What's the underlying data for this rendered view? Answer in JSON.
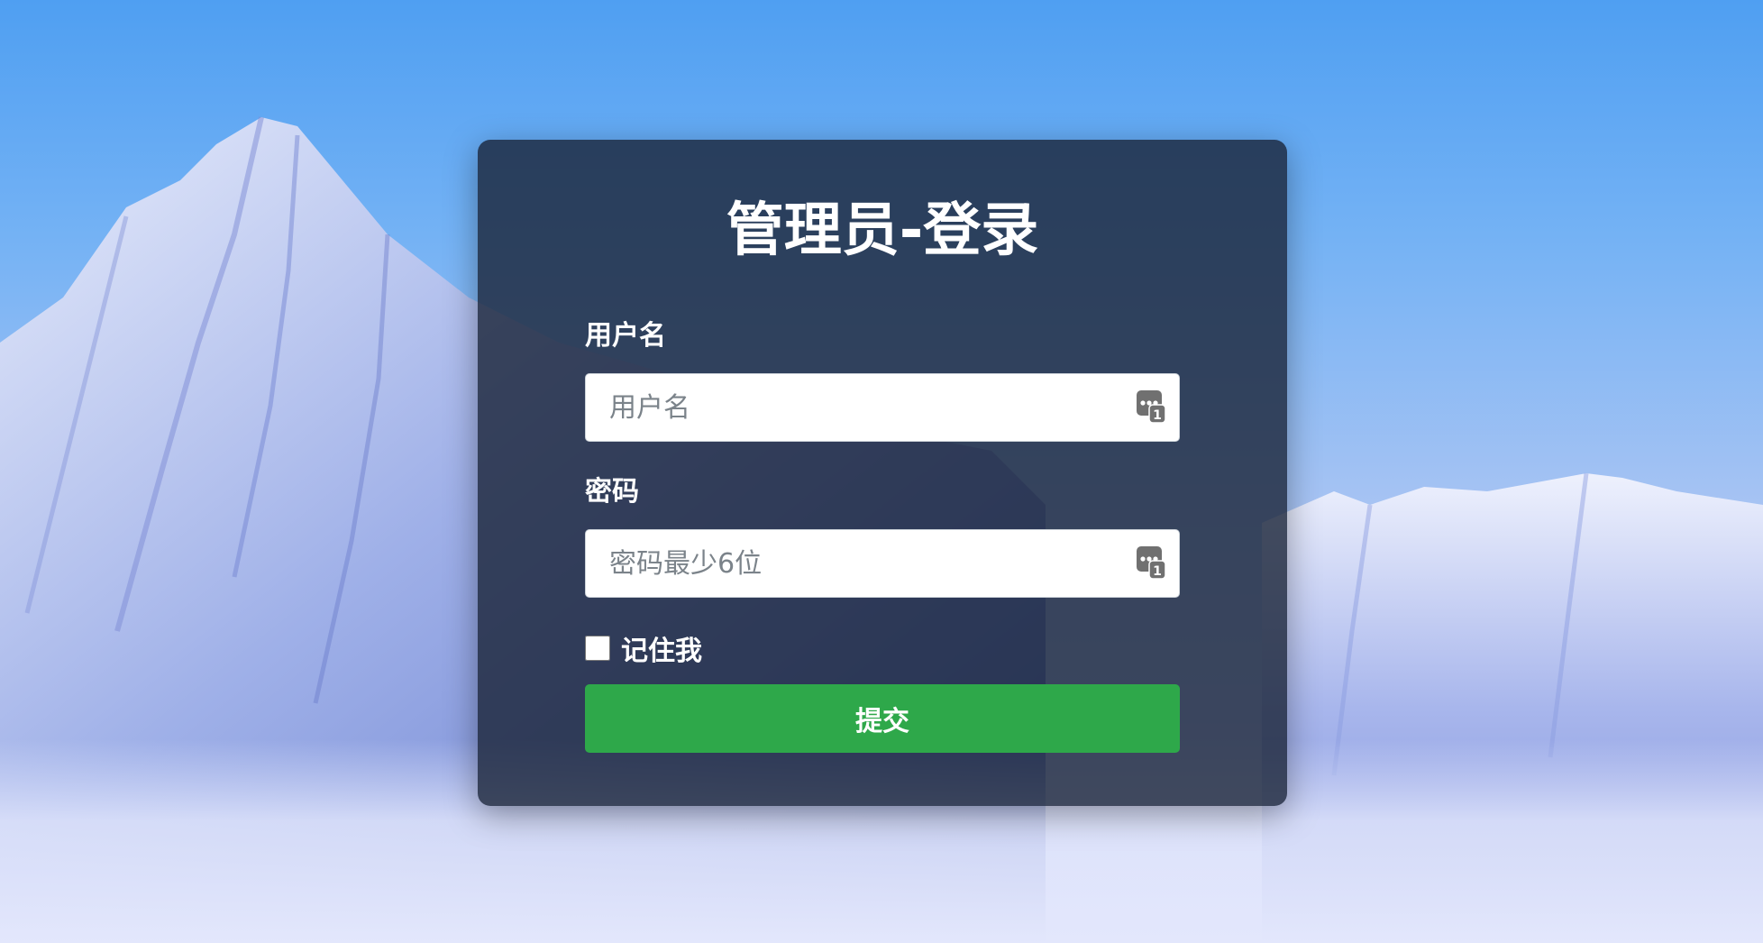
{
  "page": {
    "title": "管理员-登录"
  },
  "form": {
    "username": {
      "label": "用户名",
      "value": "",
      "placeholder": "用户名"
    },
    "password": {
      "label": "密码",
      "value": "",
      "placeholder": "密码最少6位"
    },
    "remember_me": {
      "label": "记住我",
      "checked": false
    },
    "submit_label": "提交"
  },
  "icons": {
    "username_autofill": "password-manager-icon",
    "password_autofill": "password-manager-icon"
  },
  "colors": {
    "submit_button": "#2ea84a",
    "card_background": "#19233799",
    "sky": "#4f9ff2",
    "snow": "#c3cff8"
  }
}
